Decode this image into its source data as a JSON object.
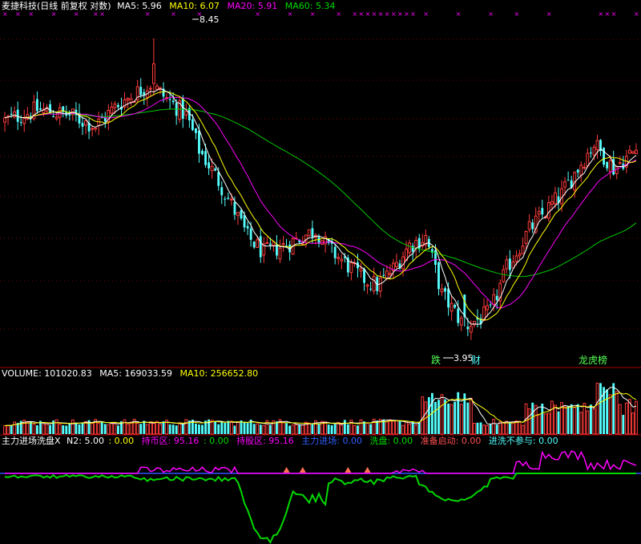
{
  "main_header": {
    "title": "麦捷科技(日线 前复权 对数)",
    "ma5": "MA5: 5.96",
    "ma10": "MA10: 6.07",
    "ma20": "MA20: 5.91",
    "ma60": "MA60: 5.34"
  },
  "annotations": {
    "high_price": "8.45",
    "low_price": "3.95",
    "tag_die": "跌",
    "tag_cai": "财",
    "tag_lhb": "龙虎榜"
  },
  "volume_header": {
    "volume": "VOLUME: 101020.83",
    "ma5": "MA5: 169033.59",
    "ma10": "MA10: 256652.80"
  },
  "indicator_header": {
    "name": "主力进场洗盘X",
    "n2": "N2: 5.00",
    "v1": ": 0.00",
    "chibi": "持币区: 95.16",
    "chibi_v": ": 0.00",
    "chigu": "持股区: 95.16",
    "zhuli": "主力进场: 0.00",
    "xipan": "洗盘: 0.00",
    "zhunbei": "准备启动: 0.00",
    "jinxi": "进洗不参与: 0.00"
  },
  "colors": {
    "up": "#ff3b3b",
    "down": "#54ffff",
    "ma5": "#ffffff",
    "ma10": "#ffff00",
    "ma20": "#ff00ff",
    "ma60": "#00c800",
    "grid": "#7a0000",
    "indicator_green": "#00d800",
    "indicator_magenta": "#ff00ff",
    "indicator_blue": "#3050ff"
  },
  "chart_data": {
    "type": "candlestick",
    "price_keypoints": [
      [
        0,
        6.8
      ],
      [
        10,
        7.0
      ],
      [
        20,
        6.9
      ],
      [
        28,
        6.7
      ],
      [
        35,
        7.1
      ],
      [
        45,
        7.5
      ],
      [
        50,
        7.2
      ],
      [
        56,
        6.9
      ],
      [
        60,
        6.3
      ],
      [
        66,
        5.8
      ],
      [
        75,
        5.0
      ],
      [
        80,
        4.8
      ],
      [
        87,
        4.9
      ],
      [
        96,
        5.1
      ],
      [
        100,
        4.85
      ],
      [
        110,
        4.5
      ],
      [
        115,
        4.4
      ],
      [
        120,
        4.6
      ],
      [
        125,
        4.9
      ],
      [
        130,
        5.0
      ],
      [
        135,
        4.3
      ],
      [
        142,
        3.95
      ],
      [
        150,
        4.1
      ],
      [
        155,
        4.6
      ],
      [
        162,
        5.1
      ],
      [
        172,
        5.6
      ],
      [
        182,
        6.4
      ],
      [
        188,
        6.0
      ],
      [
        195,
        6.3
      ]
    ],
    "price_high": 8.45,
    "price_low": 3.95,
    "price_range": [
      3.7,
      9.0
    ],
    "candle_count": 196
  }
}
